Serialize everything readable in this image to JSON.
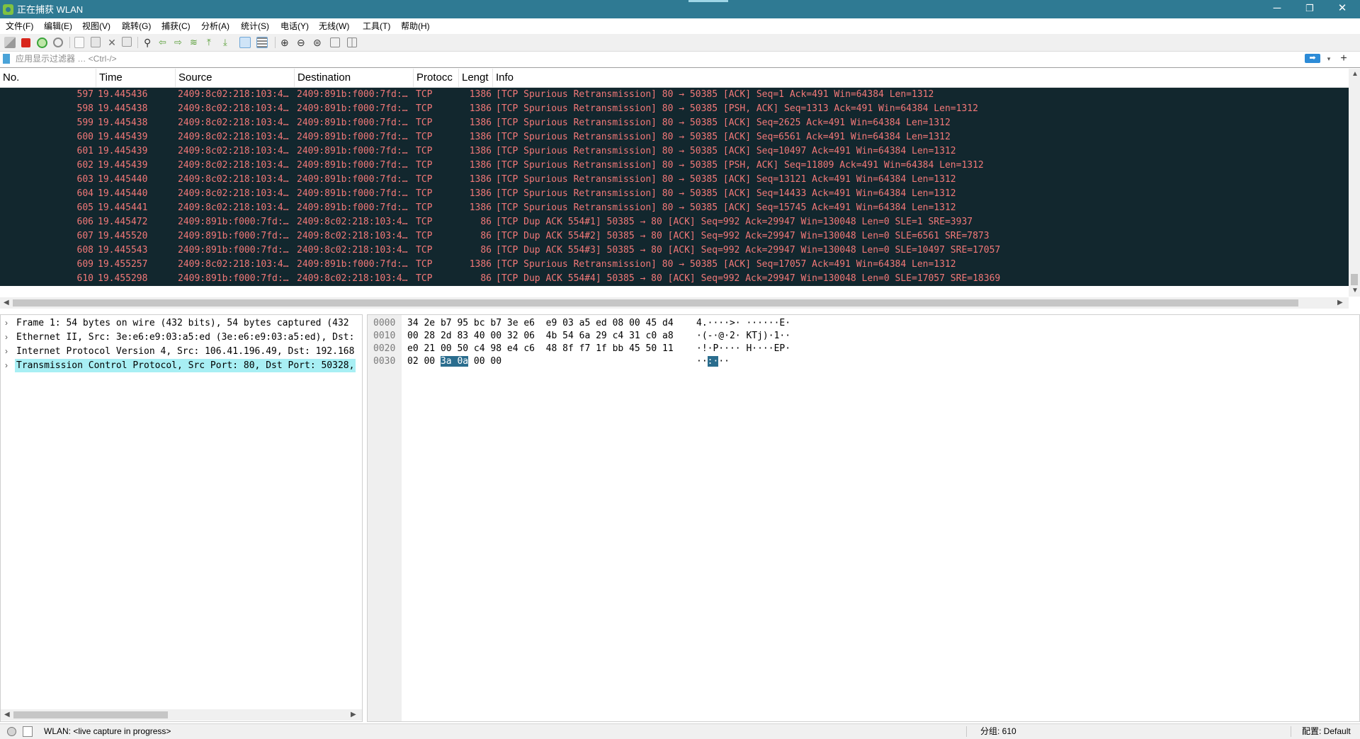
{
  "window": {
    "title": "正在捕获 WLAN",
    "minimize": "─",
    "maximize": "❐",
    "close": "✕"
  },
  "menu": [
    "文件(F)",
    "编辑(E)",
    "视图(V)",
    "跳转(G)",
    "捕获(C)",
    "分析(A)",
    "统计(S)",
    "电话(Y)",
    "无线(W)",
    "工具(T)",
    "帮助(H)"
  ],
  "toolbar": {
    "icons": [
      "shark-fin-start-icon",
      "stop-capture-icon",
      "restart-capture-icon",
      "capture-options-icon",
      "open-file-icon",
      "save-file-icon",
      "close-file-icon",
      "reload-file-icon",
      "find-packet-icon",
      "go-back-icon",
      "go-forward-icon",
      "go-to-packet-icon",
      "first-packet-icon",
      "last-packet-icon",
      "autoscroll-icon",
      "colorize-icon",
      "zoom-in-icon",
      "zoom-out-icon",
      "zoom-reset-icon",
      "resize-columns-icon",
      "layout-icon"
    ]
  },
  "filter": {
    "placeholder": "应用显示过滤器 … <Ctrl-/>",
    "apply_icon": "➡",
    "dropdown_icon": "▾",
    "add_icon": "+"
  },
  "packet_list": {
    "columns": [
      "No.",
      "Time",
      "Source",
      "Destination",
      "Protocc",
      "Lengt",
      "Info"
    ],
    "rows": [
      {
        "no": "597",
        "time": "19.445436",
        "src": "2409:8c02:218:103:4…",
        "dst": "2409:891b:f000:7fd:…",
        "proto": "TCP",
        "len": "1386",
        "info": "[TCP Spurious Retransmission] 80 → 50385 [ACK] Seq=1 Ack=491 Win=64384 Len=1312"
      },
      {
        "no": "598",
        "time": "19.445438",
        "src": "2409:8c02:218:103:4…",
        "dst": "2409:891b:f000:7fd:…",
        "proto": "TCP",
        "len": "1386",
        "info": "[TCP Spurious Retransmission] 80 → 50385 [PSH, ACK] Seq=1313 Ack=491 Win=64384 Len=1312"
      },
      {
        "no": "599",
        "time": "19.445438",
        "src": "2409:8c02:218:103:4…",
        "dst": "2409:891b:f000:7fd:…",
        "proto": "TCP",
        "len": "1386",
        "info": "[TCP Spurious Retransmission] 80 → 50385 [ACK] Seq=2625 Ack=491 Win=64384 Len=1312"
      },
      {
        "no": "600",
        "time": "19.445439",
        "src": "2409:8c02:218:103:4…",
        "dst": "2409:891b:f000:7fd:…",
        "proto": "TCP",
        "len": "1386",
        "info": "[TCP Spurious Retransmission] 80 → 50385 [ACK] Seq=6561 Ack=491 Win=64384 Len=1312"
      },
      {
        "no": "601",
        "time": "19.445439",
        "src": "2409:8c02:218:103:4…",
        "dst": "2409:891b:f000:7fd:…",
        "proto": "TCP",
        "len": "1386",
        "info": "[TCP Spurious Retransmission] 80 → 50385 [ACK] Seq=10497 Ack=491 Win=64384 Len=1312"
      },
      {
        "no": "602",
        "time": "19.445439",
        "src": "2409:8c02:218:103:4…",
        "dst": "2409:891b:f000:7fd:…",
        "proto": "TCP",
        "len": "1386",
        "info": "[TCP Spurious Retransmission] 80 → 50385 [PSH, ACK] Seq=11809 Ack=491 Win=64384 Len=1312"
      },
      {
        "no": "603",
        "time": "19.445440",
        "src": "2409:8c02:218:103:4…",
        "dst": "2409:891b:f000:7fd:…",
        "proto": "TCP",
        "len": "1386",
        "info": "[TCP Spurious Retransmission] 80 → 50385 [ACK] Seq=13121 Ack=491 Win=64384 Len=1312"
      },
      {
        "no": "604",
        "time": "19.445440",
        "src": "2409:8c02:218:103:4…",
        "dst": "2409:891b:f000:7fd:…",
        "proto": "TCP",
        "len": "1386",
        "info": "[TCP Spurious Retransmission] 80 → 50385 [ACK] Seq=14433 Ack=491 Win=64384 Len=1312"
      },
      {
        "no": "605",
        "time": "19.445441",
        "src": "2409:8c02:218:103:4…",
        "dst": "2409:891b:f000:7fd:…",
        "proto": "TCP",
        "len": "1386",
        "info": "[TCP Spurious Retransmission] 80 → 50385 [ACK] Seq=15745 Ack=491 Win=64384 Len=1312"
      },
      {
        "no": "606",
        "time": "19.445472",
        "src": "2409:891b:f000:7fd:…",
        "dst": "2409:8c02:218:103:4…",
        "proto": "TCP",
        "len": "86",
        "info": "[TCP Dup ACK 554#1] 50385 → 80 [ACK] Seq=992 Ack=29947 Win=130048 Len=0 SLE=1 SRE=3937"
      },
      {
        "no": "607",
        "time": "19.445520",
        "src": "2409:891b:f000:7fd:…",
        "dst": "2409:8c02:218:103:4…",
        "proto": "TCP",
        "len": "86",
        "info": "[TCP Dup ACK 554#2] 50385 → 80 [ACK] Seq=992 Ack=29947 Win=130048 Len=0 SLE=6561 SRE=7873"
      },
      {
        "no": "608",
        "time": "19.445543",
        "src": "2409:891b:f000:7fd:…",
        "dst": "2409:8c02:218:103:4…",
        "proto": "TCP",
        "len": "86",
        "info": "[TCP Dup ACK 554#3] 50385 → 80 [ACK] Seq=992 Ack=29947 Win=130048 Len=0 SLE=10497 SRE=17057"
      },
      {
        "no": "609",
        "time": "19.455257",
        "src": "2409:8c02:218:103:4…",
        "dst": "2409:891b:f000:7fd:…",
        "proto": "TCP",
        "len": "1386",
        "info": "[TCP Spurious Retransmission] 80 → 50385 [ACK] Seq=17057 Ack=491 Win=64384 Len=1312"
      },
      {
        "no": "610",
        "time": "19.455298",
        "src": "2409:891b:f000:7fd:…",
        "dst": "2409:8c02:218:103:4…",
        "proto": "TCP",
        "len": "86",
        "info": "[TCP Dup ACK 554#4] 50385 → 80 [ACK] Seq=992 Ack=29947 Win=130048 Len=0 SLE=17057 SRE=18369"
      }
    ]
  },
  "details": {
    "items": [
      {
        "label": "Frame 1: 54 bytes on wire (432 bits), 54 bytes captured (432"
      },
      {
        "label": "Ethernet II, Src: 3e:e6:e9:03:a5:ed (3e:e6:e9:03:a5:ed), Dst:"
      },
      {
        "label": "Internet Protocol Version 4, Src: 106.41.196.49, Dst: 192.168"
      },
      {
        "label": "Transmission Control Protocol, Src Port: 80, Dst Port: 50328,"
      }
    ],
    "selected_index": 3
  },
  "bytes": {
    "lines": [
      {
        "offset": "0000",
        "hex": "34 2e b7 95 bc b7 3e e6  e9 03 a5 ed 08 00 45 d4",
        "ascii": "4.····>· ······E·"
      },
      {
        "offset": "0010",
        "hex": "00 28 2d 83 40 00 32 06  4b 54 6a 29 c4 31 c0 a8",
        "ascii": "·(-·@·2· KTj)·1··"
      },
      {
        "offset": "0020",
        "hex": "e0 21 00 50 c4 98 e4 c6  48 8f f7 1f bb 45 50 11",
        "ascii": "·!·P···· H····EP·"
      },
      {
        "offset": "0030",
        "hex_pre": "02 00 ",
        "hex_hl": "3a 0a",
        "hex_post": " 00 00",
        "ascii_pre": "··",
        "ascii_hl": ":·",
        "ascii_post": "··"
      }
    ]
  },
  "status": {
    "interface": "WLAN: <live capture in progress>",
    "packets": "分组: 610",
    "profile": "配置: Default"
  },
  "colors": {
    "packet_bg": "#12272e",
    "packet_fg": "#f27878",
    "selected_detail": "#a8eff4",
    "hex_highlight": "#2a6d8e",
    "titlebar": "#2f7a93"
  }
}
